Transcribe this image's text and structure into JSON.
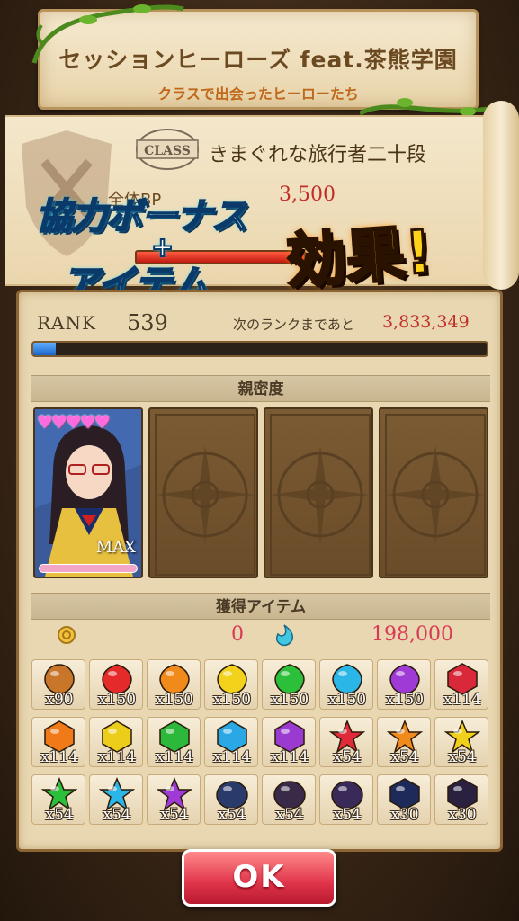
{
  "header": {
    "title": "セッションヒーローズ feat.茶熊学園",
    "subtitle": "クラスで出会ったヒーローたち"
  },
  "class_info": {
    "badge": "CLASS",
    "name": "きまぐれな旅行者二十段",
    "bp_label": "全体BP",
    "bp_value": "3,500"
  },
  "promo": {
    "line1": "協力ボーナス",
    "plus": "+",
    "line2": "アイテム",
    "effect": "効果!"
  },
  "rank": {
    "label": "RANK",
    "value": "539",
    "next_label": "次のランクまであと",
    "next_value": "3,833,349",
    "exp_progress": 0.05
  },
  "affinity": {
    "header": "親密度",
    "hearts": "♥♥♥♥♥",
    "max_label": "MAX"
  },
  "items_section": {
    "header": "獲得アイテム",
    "coin_value": "0",
    "gem_value": "198,000",
    "items": [
      {
        "icon": "gold-badge-icon",
        "color": "#c9762a",
        "qty": "x90"
      },
      {
        "icon": "red-rune-icon",
        "color": "#e52a2a",
        "qty": "x150"
      },
      {
        "icon": "orange-rune-icon",
        "color": "#f08a1a",
        "qty": "x150"
      },
      {
        "icon": "yellow-rune-icon",
        "color": "#f2d21a",
        "qty": "x150"
      },
      {
        "icon": "green-rune-icon",
        "color": "#2bbf3a",
        "qty": "x150"
      },
      {
        "icon": "cyan-rune-icon",
        "color": "#2ab6e6",
        "qty": "x150"
      },
      {
        "icon": "purple-rune-icon",
        "color": "#a03ad6",
        "qty": "x150"
      },
      {
        "icon": "red-hex-rune-icon",
        "color": "#d8283a",
        "qty": "x114"
      },
      {
        "icon": "orange-hex-rune-icon",
        "color": "#f07a18",
        "qty": "x114"
      },
      {
        "icon": "yellow-hex-rune-icon",
        "color": "#eccd1a",
        "qty": "x114"
      },
      {
        "icon": "green-hex-rune-icon",
        "color": "#2cb83a",
        "qty": "x114"
      },
      {
        "icon": "cyan-hex-rune-icon",
        "color": "#2aa8e6",
        "qty": "x114"
      },
      {
        "icon": "purple-hex-rune-icon",
        "color": "#9a3ad0",
        "qty": "x114"
      },
      {
        "icon": "red-star-rune-icon",
        "color": "#e02a3a",
        "qty": "x54"
      },
      {
        "icon": "orange-star-rune-icon",
        "color": "#f08a1a",
        "qty": "x54"
      },
      {
        "icon": "yellow-star-rune-icon",
        "color": "#f0d01a",
        "qty": "x54"
      },
      {
        "icon": "green-star-rune-icon",
        "color": "#2cbf3a",
        "qty": "x54"
      },
      {
        "icon": "cyan-star-rune-icon",
        "color": "#2ab6e6",
        "qty": "x54"
      },
      {
        "icon": "purple-star-rune-icon",
        "color": "#a03ad6",
        "qty": "x54"
      },
      {
        "icon": "dark-orb-blue-icon",
        "color": "#2a3a6a",
        "qty": "x54"
      },
      {
        "icon": "dark-orb-pink-icon",
        "color": "#3a2a4a",
        "qty": "x54"
      },
      {
        "icon": "dark-orb-purple-icon",
        "color": "#3a2a5a",
        "qty": "x54"
      },
      {
        "icon": "dark-hex-blue-icon",
        "color": "#1e2a5a",
        "qty": "x30"
      },
      {
        "icon": "dark-hex-pink-icon",
        "color": "#2a2040",
        "qty": "x30"
      }
    ]
  },
  "actions": {
    "ok_label": "OK"
  }
}
